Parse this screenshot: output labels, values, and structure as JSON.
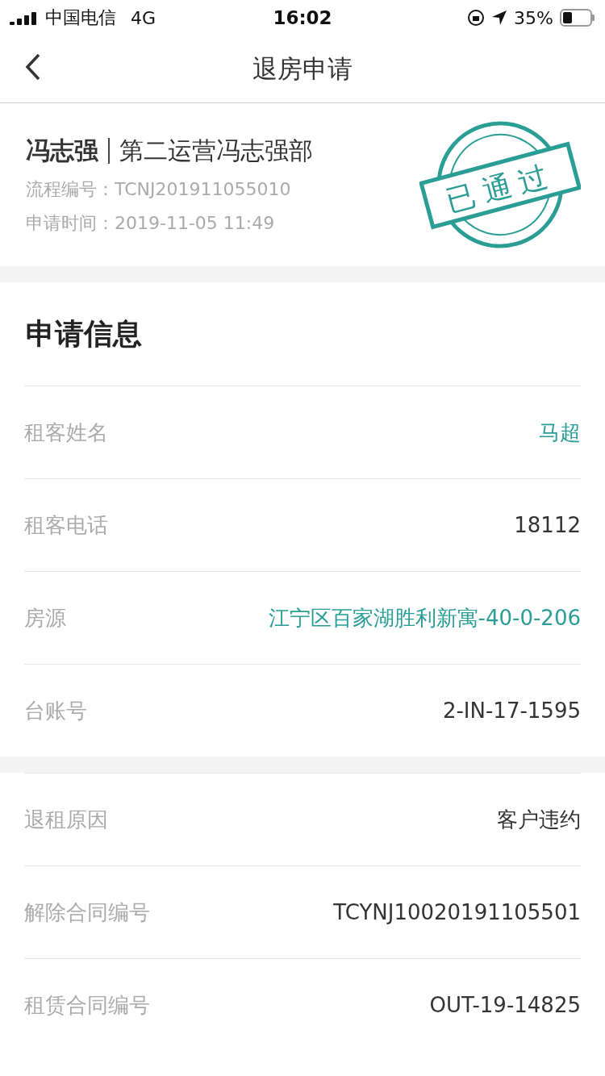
{
  "status_bar": {
    "carrier": "中国电信",
    "network": "4G",
    "time": "16:02",
    "battery": "35%"
  },
  "nav": {
    "title": "退房申请"
  },
  "header": {
    "name": "冯志强",
    "department": "第二运营冯志强部",
    "process_no": "流程编号：TCNJ201911055010",
    "apply_time": "申请时间：2019-11-05 11:49",
    "stamp": "已通过"
  },
  "sections": [
    {
      "title": "申请信息",
      "rows": [
        {
          "label": "租客姓名",
          "value": "马超",
          "kind": "link"
        },
        {
          "label": "租客电话",
          "value": "18112",
          "kind": "text"
        },
        {
          "label": "房源",
          "value": "江宁区百家湖胜利新寓-40-0-206",
          "kind": "link"
        },
        {
          "label": "台账号",
          "value": "2-IN-17-1595",
          "kind": "text"
        }
      ]
    },
    {
      "rows": [
        {
          "label": "退租原因",
          "value": "客户违约",
          "kind": "text"
        },
        {
          "label": "解除合同编号",
          "value": "TCYNJ10020191105501",
          "kind": "text"
        },
        {
          "label": "租赁合同编号",
          "value": "OUT-19-14825",
          "kind": "text"
        }
      ]
    }
  ]
}
